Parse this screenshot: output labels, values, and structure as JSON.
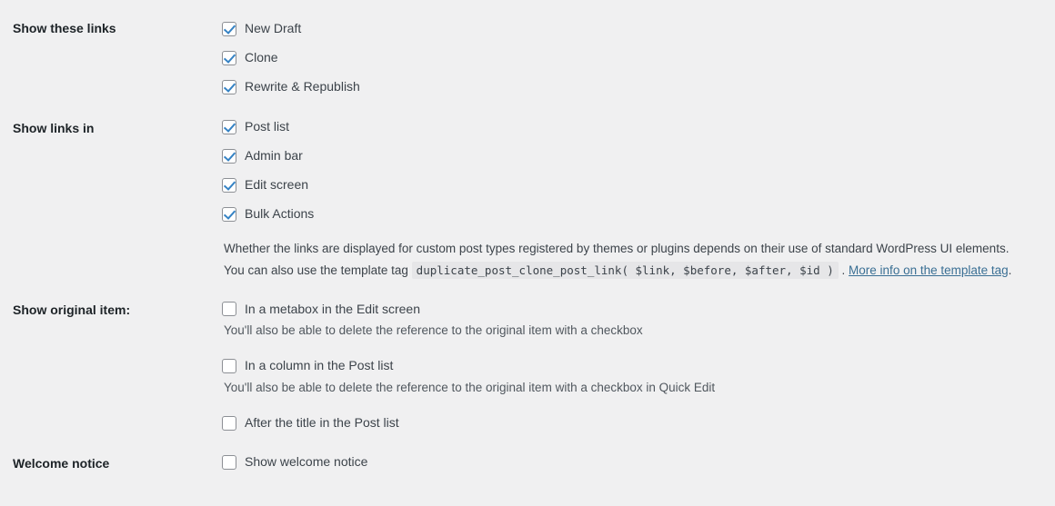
{
  "sections": [
    {
      "label": "Show these links",
      "options": [
        {
          "label": "New Draft",
          "checked": true
        },
        {
          "label": "Clone",
          "checked": true
        },
        {
          "label": "Rewrite & Republish",
          "checked": true
        }
      ]
    },
    {
      "label": "Show links in",
      "options": [
        {
          "label": "Post list",
          "checked": true
        },
        {
          "label": "Admin bar",
          "checked": true
        },
        {
          "label": "Edit screen",
          "checked": true
        },
        {
          "label": "Bulk Actions",
          "checked": true
        }
      ],
      "description": {
        "line1": "Whether the links are displayed for custom post types registered by themes or plugins depends on their use of standard WordPress UI elements.",
        "line2_prefix": "You can also use the template tag",
        "code": "duplicate_post_clone_post_link( $link, $before, $after, $id )",
        "line2_separator": ".",
        "link_text": "More info on the template tag",
        "line2_suffix": "."
      }
    },
    {
      "label": "Show original item:",
      "groups": [
        {
          "option": {
            "label": "In a metabox in the Edit screen",
            "checked": false
          },
          "helper": "You'll also be able to delete the reference to the original item with a checkbox"
        },
        {
          "option": {
            "label": "In a column in the Post list",
            "checked": false
          },
          "helper": "You'll also be able to delete the reference to the original item with a checkbox in Quick Edit"
        },
        {
          "option": {
            "label": "After the title in the Post list",
            "checked": false
          },
          "helper": ""
        }
      ]
    },
    {
      "label": "Welcome notice",
      "options": [
        {
          "label": "Show welcome notice",
          "checked": false
        }
      ]
    }
  ],
  "colors": {
    "background": "#f0f0f1",
    "label_text": "#1d2327",
    "body_text": "#3c434a",
    "helper_text": "#50575e",
    "checkbox_border": "#8c8f94",
    "checkmark": "#3582c4",
    "link": "#3a6f94",
    "code_background": "#e6e6e8"
  }
}
